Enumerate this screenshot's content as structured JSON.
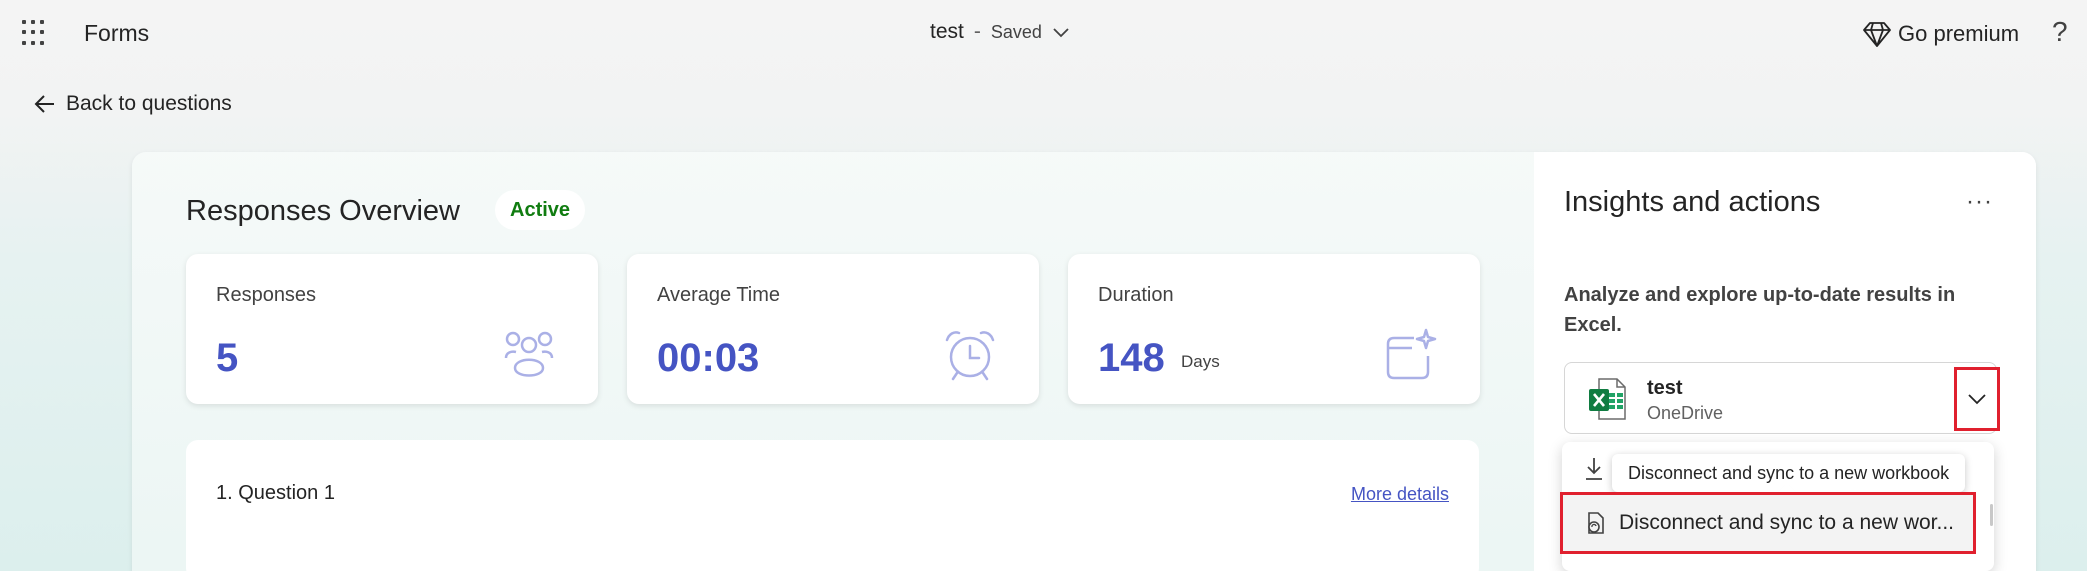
{
  "topbar": {
    "app_name": "Forms",
    "doc_title": "test",
    "separator": "-",
    "save_status": "Saved",
    "premium_label": "Go premium",
    "help_label": "?"
  },
  "nav": {
    "back_label": "Back to questions"
  },
  "overview": {
    "title": "Responses Overview",
    "status_badge": "Active",
    "stats": [
      {
        "label": "Responses",
        "value": "5",
        "icon": "people-icon"
      },
      {
        "label": "Average Time",
        "value": "00:03",
        "icon": "alarm-clock-icon"
      },
      {
        "label": "Duration",
        "value": "148",
        "unit": "Days",
        "icon": "calendar-sparkle-icon"
      }
    ],
    "question": {
      "title": "1. Question 1",
      "link": "More details"
    }
  },
  "insights": {
    "title": "Insights and actions",
    "more_label": "···",
    "description": "Analyze and explore up-to-date results in Excel.",
    "file": {
      "name": "test",
      "location": "OneDrive",
      "icon": "excel-icon"
    },
    "menu": {
      "tooltip": "Disconnect and sync to a new workbook",
      "item_label": "Disconnect and sync to a new wor..."
    }
  },
  "colors": {
    "accent": "#4554c3",
    "active": "#107c10",
    "highlight": "#e0202e"
  }
}
